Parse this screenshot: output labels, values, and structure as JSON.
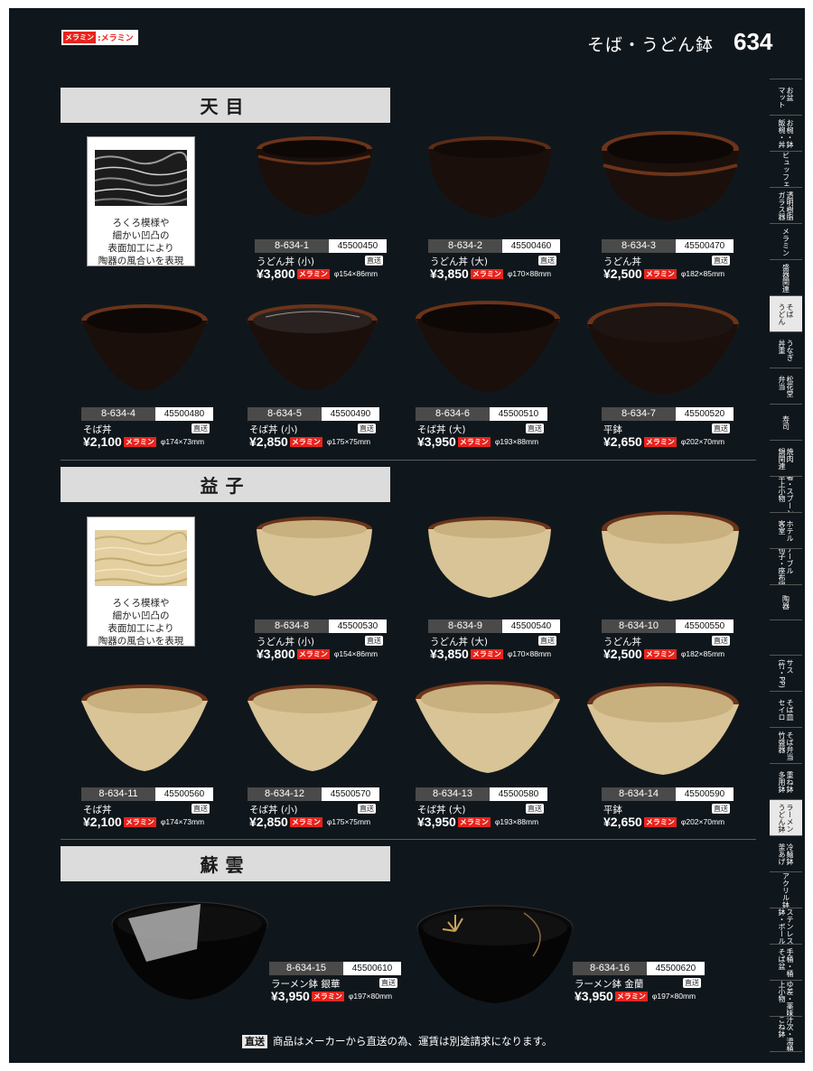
{
  "legend": {
    "tag": "メラミン",
    "label": ":メラミン"
  },
  "header": {
    "title": "そば・うどん鉢",
    "page_number": "634"
  },
  "sections": [
    {
      "name": "天目",
      "texture_text": [
        "ろくろ模様や",
        "細かい凹凸の",
        "表面加工により",
        "陶器の風合いを表現"
      ],
      "products": [
        {
          "code": "8-634-1",
          "jan": "45500450",
          "name": "うどん丼 (小)",
          "direct": "直送",
          "price": "¥3,800",
          "material": "メラミン",
          "size": "φ154×86mm"
        },
        {
          "code": "8-634-2",
          "jan": "45500460",
          "name": "うどん丼 (大)",
          "direct": "直送",
          "price": "¥3,850",
          "material": "メラミン",
          "size": "φ170×88mm"
        },
        {
          "code": "8-634-3",
          "jan": "45500470",
          "name": "うどん丼",
          "direct": "直送",
          "price": "¥2,500",
          "material": "メラミン",
          "size": "φ182×85mm"
        },
        {
          "code": "8-634-4",
          "jan": "45500480",
          "name": "そば丼",
          "direct": "直送",
          "price": "¥2,100",
          "material": "メラミン",
          "size": "φ174×73mm"
        },
        {
          "code": "8-634-5",
          "jan": "45500490",
          "name": "そば丼 (小)",
          "direct": "直送",
          "price": "¥2,850",
          "material": "メラミン",
          "size": "φ175×75mm"
        },
        {
          "code": "8-634-6",
          "jan": "45500510",
          "name": "そば丼 (大)",
          "direct": "直送",
          "price": "¥3,950",
          "material": "メラミン",
          "size": "φ193×88mm"
        },
        {
          "code": "8-634-7",
          "jan": "45500520",
          "name": "平鉢",
          "direct": "直送",
          "price": "¥2,650",
          "material": "メラミン",
          "size": "φ202×70mm"
        }
      ]
    },
    {
      "name": "益子",
      "texture_text": [
        "ろくろ模様や",
        "細かい凹凸の",
        "表面加工により",
        "陶器の風合いを表現"
      ],
      "products": [
        {
          "code": "8-634-8",
          "jan": "45500530",
          "name": "うどん丼 (小)",
          "direct": "直送",
          "price": "¥3,800",
          "material": "メラミン",
          "size": "φ154×86mm"
        },
        {
          "code": "8-634-9",
          "jan": "45500540",
          "name": "うどん丼 (大)",
          "direct": "直送",
          "price": "¥3,850",
          "material": "メラミン",
          "size": "φ170×88mm"
        },
        {
          "code": "8-634-10",
          "jan": "45500550",
          "name": "うどん丼",
          "direct": "直送",
          "price": "¥2,500",
          "material": "メラミン",
          "size": "φ182×85mm"
        },
        {
          "code": "8-634-11",
          "jan": "45500560",
          "name": "そば丼",
          "direct": "直送",
          "price": "¥2,100",
          "material": "メラミン",
          "size": "φ174×73mm"
        },
        {
          "code": "8-634-12",
          "jan": "45500570",
          "name": "そば丼 (小)",
          "direct": "直送",
          "price": "¥2,850",
          "material": "メラミン",
          "size": "φ175×75mm"
        },
        {
          "code": "8-634-13",
          "jan": "45500580",
          "name": "そば丼 (大)",
          "direct": "直送",
          "price": "¥3,950",
          "material": "メラミン",
          "size": "φ193×88mm"
        },
        {
          "code": "8-634-14",
          "jan": "45500590",
          "name": "平鉢",
          "direct": "直送",
          "price": "¥2,650",
          "material": "メラミン",
          "size": "φ202×70mm"
        }
      ]
    },
    {
      "name": "蘇雲",
      "products": [
        {
          "code": "8-634-15",
          "jan": "45500610",
          "name": "ラーメン鉢 銀華",
          "direct": "直送",
          "price": "¥3,950",
          "material": "メラミン",
          "size": "φ197×80mm"
        },
        {
          "code": "8-634-16",
          "jan": "45500620",
          "name": "ラーメン鉢 金蘭",
          "direct": "直送",
          "price": "¥3,950",
          "material": "メラミン",
          "size": "φ197×80mm"
        }
      ]
    }
  ],
  "sidebar": [
    "お盆\nマット",
    "お椀・鉢\n飯椀・丼",
    "ビュッフェ",
    "透明樹脂\nガラス器",
    "メラミン",
    "盛器関連",
    "そば\nうどん",
    "うなぎ\n丼重",
    "松花堂\n弁当",
    "寿司",
    "焼肉\n鍋関連",
    "箸・スプーン\n卓上小物",
    "ホテル\n客室",
    "テーブル\n椅子・座布団",
    "陶器",
    "サス\n(竹・PP)",
    "そば皿\nセイロ",
    "そば弁当\n竹盛器",
    "重ね鉢\n多用鉢",
    "ラーメン\nうどん鉢",
    "冷麺鉢\n釜あげ",
    "アクリル鉢",
    "ステンレス\n鉢・ボール",
    "手桶・桶\nそば盆",
    "つゆ差・薬味入\n卓上小物",
    "汁次・湯桶\nこね鉢"
  ],
  "footer": {
    "badge": "直送",
    "text": "商品はメーカーから直送の為、運賃は別途請求になります。"
  },
  "colors": {
    "background": "#10171c",
    "accent": "#e8231c",
    "tenmoku": "#1a0f0b",
    "mashiko": "#d9c497",
    "rim": "#6b3419"
  }
}
